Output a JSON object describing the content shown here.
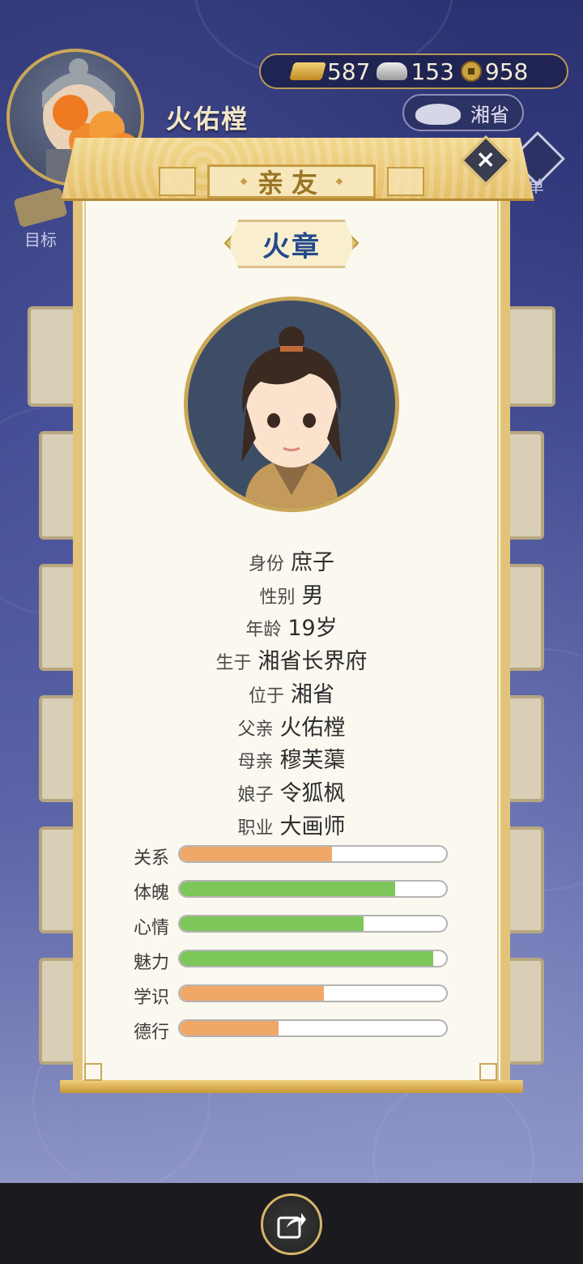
{
  "window": {
    "title": "亲友"
  },
  "player": {
    "name": "火佑樘"
  },
  "currency": {
    "gold": "587",
    "silver": "153",
    "copper": "958"
  },
  "location_label": "湘省",
  "side_buttons": {
    "goal": "目标",
    "menu": "菜单"
  },
  "character": {
    "name": "火章",
    "info": [
      {
        "key": "身份",
        "value": "庶子"
      },
      {
        "key": "性别",
        "value": "男"
      },
      {
        "key": "年龄",
        "value": "19岁"
      },
      {
        "key": "生于",
        "value": "湘省长界府"
      },
      {
        "key": "位于",
        "value": "湘省"
      },
      {
        "key": "父亲",
        "value": "火佑樘"
      },
      {
        "key": "母亲",
        "value": "穆芙蕖"
      },
      {
        "key": "娘子",
        "value": "令狐枫"
      },
      {
        "key": "职业",
        "value": "大画师"
      }
    ],
    "stats": [
      {
        "label": "关系",
        "value": 0.57,
        "color": "#f0a868"
      },
      {
        "label": "体魄",
        "value": 0.81,
        "color": "#7dc65a"
      },
      {
        "label": "心情",
        "value": 0.69,
        "color": "#7dc65a"
      },
      {
        "label": "魅力",
        "value": 0.95,
        "color": "#7dc65a"
      },
      {
        "label": "学识",
        "value": 0.54,
        "color": "#f0a868"
      },
      {
        "label": "德行",
        "value": 0.37,
        "color": "#f0a868"
      }
    ]
  },
  "icons": [
    "close-icon",
    "share-icon",
    "gold-ingot-icon",
    "silver-ingot-icon",
    "copper-coin-icon",
    "inkstone-icon"
  ]
}
